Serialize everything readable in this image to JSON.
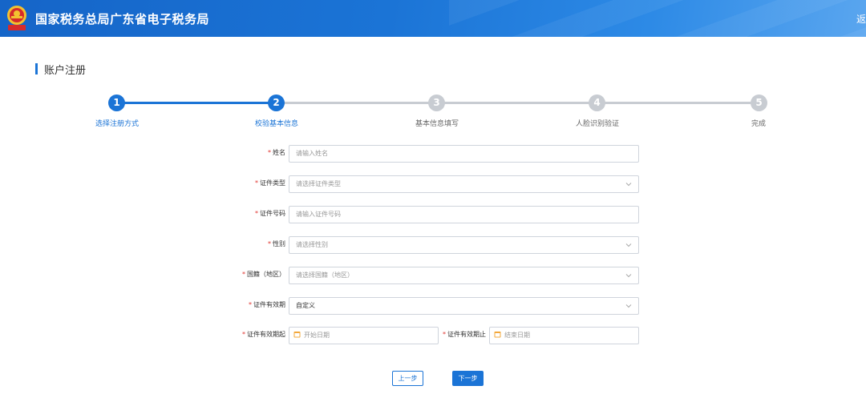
{
  "header": {
    "site_title": "国家税务总局广东省电子税务局",
    "return_label": "返回",
    "brand_color": "#1b74d6"
  },
  "page": {
    "heading": "账户注册"
  },
  "steps": [
    {
      "number": "1",
      "label": "选择注册方式",
      "state": "done"
    },
    {
      "number": "2",
      "label": "校验基本信息",
      "state": "active"
    },
    {
      "number": "3",
      "label": "基本信息填写",
      "state": "pending"
    },
    {
      "number": "4",
      "label": "人脸识别验证",
      "state": "pending"
    },
    {
      "number": "5",
      "label": "完成",
      "state": "pending"
    }
  ],
  "form": {
    "name": {
      "label": "姓名",
      "placeholder": "请输入姓名"
    },
    "id_type": {
      "label": "证件类型",
      "placeholder": "请选择证件类型"
    },
    "id_number": {
      "label": "证件号码",
      "placeholder": "请输入证件号码"
    },
    "gender": {
      "label": "性别",
      "placeholder": "请选择性别"
    },
    "nationality": {
      "label": "国籍（地区）",
      "placeholder": "请选择国籍（地区）"
    },
    "validity": {
      "label": "证件有效期",
      "value": "自定义"
    },
    "validity_start": {
      "label": "证件有效期起",
      "placeholder": "开始日期"
    },
    "validity_end": {
      "label": "证件有效期止",
      "placeholder": "结束日期"
    }
  },
  "buttons": {
    "prev": "上一步",
    "next": "下一步"
  },
  "colors": {
    "active": "#1b74d6",
    "pending": "#c8ccd2",
    "required": "#e0332e"
  }
}
